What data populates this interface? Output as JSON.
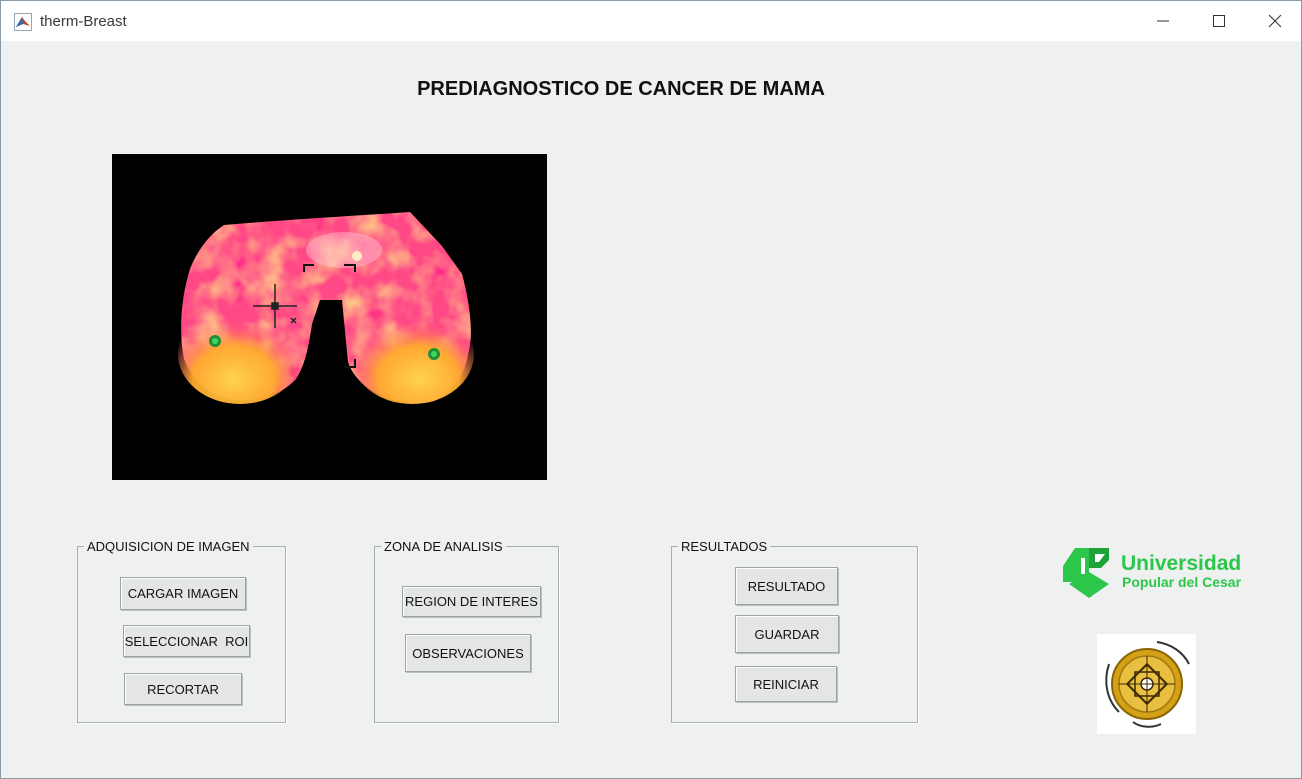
{
  "window": {
    "title": "therm-Breast",
    "icons": {
      "app": "matlab-icon",
      "minimize": "minimize-icon",
      "maximize": "maximize-icon",
      "close": "close-icon"
    }
  },
  "main": {
    "heading": "PREDIAGNOSTICO DE CANCER DE MAMA"
  },
  "image_view": {
    "content": "breast-thermogram",
    "cursor": "crosshair-icon",
    "selection": "roi-selection-box"
  },
  "panels": {
    "adquisicion": {
      "title": "ADQUISICION DE IMAGEN",
      "buttons": {
        "cargar": "CARGAR IMAGEN",
        "seleccionar": "SELECCIONAR  ROI",
        "recortar": "RECORTAR"
      }
    },
    "zona": {
      "title": "ZONA DE ANALISIS",
      "buttons": {
        "region": "REGION DE INTERES",
        "observaciones": "OBSERVACIONES"
      }
    },
    "resultados": {
      "title": "RESULTADOS",
      "buttons": {
        "resultado": "RESULTADO",
        "guardar": "GUARDAR",
        "reiniciar": "REINICIAR"
      }
    }
  },
  "logos": {
    "university": {
      "line1": "Universidad",
      "line2": "Popular del Cesar"
    },
    "seal": "research-group-seal"
  },
  "colors": {
    "background": "#eef1f0",
    "button": "#e3e6e5",
    "university_green": "#2cc64a",
    "seal_gold": "#d4a017"
  }
}
